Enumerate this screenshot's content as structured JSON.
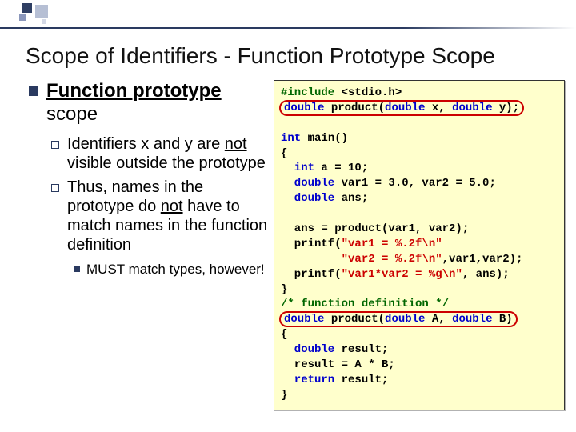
{
  "title": "Scope of Identifiers - Function Prototype Scope",
  "bullets": {
    "head_bold": "Function prototype",
    "head_rest": " scope",
    "sub1_a": "Identifiers x and y are ",
    "sub1_not": "not",
    "sub1_b": " visible outside the prototype",
    "sub2_a": "Thus, names in the prototype do ",
    "sub2_not": "not",
    "sub2_b": " have to match names in the function definition",
    "subsub": "MUST match types, however!"
  },
  "code": {
    "l01a": "#include",
    "l01b": " <stdio.h>",
    "l02a": "double",
    "l02b": " product(",
    "l02c": "double",
    "l02d": " x, ",
    "l02e": "double",
    "l02f": " y);",
    "blank1": " ",
    "l03a": "int",
    "l03b": " main()",
    "l04": "{",
    "l05a": "  int",
    "l05b": " a = 10;",
    "l06a": "  double",
    "l06b": " var1 = 3.0, var2 = 5.0;",
    "l07a": "  double",
    "l07b": " ans;",
    "blank2": " ",
    "l08": "  ans = product(var1, var2);",
    "l09a": "  printf(",
    "l09b": "\"var1 = %.2f\\n\"",
    "l10a": "         \"var2 = %.2f\\n\"",
    "l10b": ",var1,var2);",
    "l11a": "  printf(",
    "l11b": "\"var1*var2 = %g\\n\"",
    "l11c": ", ans);",
    "l12": "}",
    "l13": "/* function definition */",
    "l14a": "double",
    "l14b": " product(",
    "l14c": "double",
    "l14d": " A, ",
    "l14e": "double",
    "l14f": " B)",
    "l15": "{",
    "l16a": "  double",
    "l16b": " result;",
    "l17": "  result = A * B;",
    "l18a": "  return",
    "l18b": " result;",
    "l19": "}"
  }
}
